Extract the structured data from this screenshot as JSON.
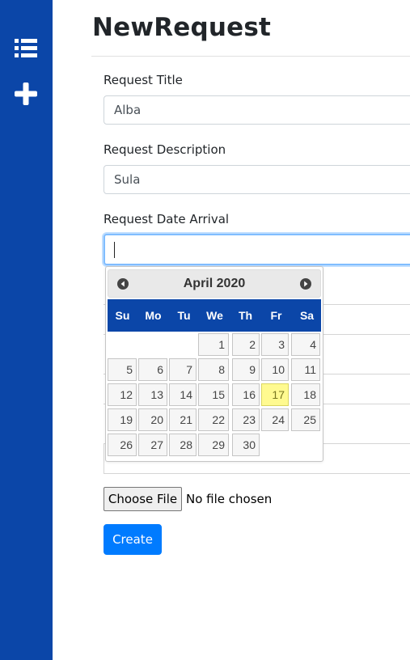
{
  "sidebar": {
    "items": [
      {
        "icon": "list-icon"
      },
      {
        "icon": "plus-icon"
      }
    ],
    "bg_color": "#0b46a8"
  },
  "header": {
    "title": "NewRequest"
  },
  "form": {
    "title_label": "Request Title",
    "title_value": "Alba",
    "description_label": "Request Description",
    "description_value": "Sula",
    "date_label": "Request Date Arrival",
    "date_value": ""
  },
  "datepicker": {
    "month_label": "April 2020",
    "prev_icon": "prev-month-icon",
    "next_icon": "next-month-icon",
    "weekdays": [
      "Su",
      "Mo",
      "Tu",
      "We",
      "Th",
      "Fr",
      "Sa"
    ],
    "first_weekday_index": 3,
    "days_in_month": 30,
    "highlighted_day": "17",
    "days": [
      "1",
      "2",
      "3",
      "4",
      "5",
      "6",
      "7",
      "8",
      "9",
      "10",
      "11",
      "12",
      "13",
      "14",
      "15",
      "16",
      "17",
      "18",
      "19",
      "20",
      "21",
      "22",
      "23",
      "24",
      "25",
      "26",
      "27",
      "28",
      "29",
      "30"
    ]
  },
  "file_input": {
    "button_label": "Choose File",
    "status": "No file chosen"
  },
  "actions": {
    "create_label": "Create"
  },
  "colors": {
    "accent": "#007bff",
    "highlight": "#fffa90",
    "header_blue": "#0b46a8"
  }
}
